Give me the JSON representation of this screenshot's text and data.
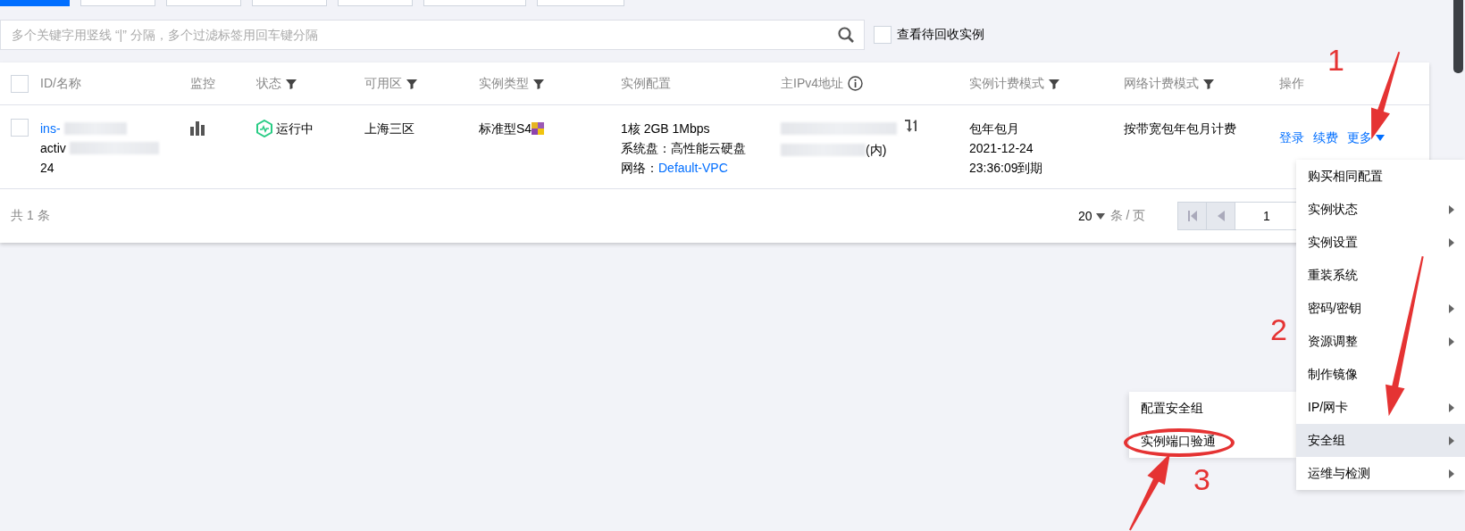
{
  "toolbar_buttons": [
    {
      "kind": "primary"
    },
    {
      "kind": "default"
    },
    {
      "kind": "default"
    },
    {
      "kind": "default"
    },
    {
      "kind": "default"
    },
    {
      "kind": "default"
    },
    {
      "kind": "default"
    }
  ],
  "search": {
    "placeholder": "多个关键字用竖线 “|” 分隔，多个过滤标签用回车键分隔"
  },
  "recycle_toggle": {
    "label": "查看待回收实例",
    "checked": false
  },
  "table": {
    "select_all": {
      "checked": false
    },
    "columns": [
      {
        "label": "ID/名称",
        "kind": "plain"
      },
      {
        "label": "监控",
        "kind": "plain"
      },
      {
        "label": "状态",
        "kind": "filter"
      },
      {
        "label": "可用区",
        "kind": "filter"
      },
      {
        "label": "实例类型",
        "kind": "filter"
      },
      {
        "label": "实例配置",
        "kind": "plain"
      },
      {
        "label": "主IPv4地址",
        "kind": "info"
      },
      {
        "label": "实例计费模式",
        "kind": "filter"
      },
      {
        "label": "网络计费模式",
        "kind": "filter"
      },
      {
        "label": "操作",
        "kind": "plain"
      }
    ],
    "rows": [
      {
        "checked": false,
        "id": "ins-",
        "name": "activ",
        "name_end": "24",
        "status": "运行中",
        "zone": "上海三区",
        "type": "标准型S4",
        "config": [
          "1核 2GB 1Mbps",
          "系统盘：高性能云硬盘"
        ],
        "network_label": "网络：",
        "network": "Default-VPC",
        "ip_note": "(内)",
        "billing": [
          "包年包月",
          "2021-12-24",
          "23:36:09到期"
        ],
        "network_billing": "按带宽包年包月计费",
        "actions": [
          "登录",
          "续费",
          "更多"
        ]
      }
    ]
  },
  "footer": {
    "total": "共 1 条",
    "page_size": "20",
    "page_size_unit": "条 / 页",
    "page": "1"
  },
  "menu": {
    "items": [
      {
        "label": "购买相同配置",
        "submenu": false,
        "selected": false
      },
      {
        "label": "实例状态",
        "submenu": true,
        "selected": false
      },
      {
        "label": "实例设置",
        "submenu": true,
        "selected": false
      },
      {
        "label": "重装系统",
        "submenu": false,
        "selected": false
      },
      {
        "label": "密码/密钥",
        "submenu": true,
        "selected": false
      },
      {
        "label": "资源调整",
        "submenu": true,
        "selected": false
      },
      {
        "label": "制作镜像",
        "submenu": false,
        "selected": false
      },
      {
        "label": "IP/网卡",
        "submenu": true,
        "selected": false
      },
      {
        "label": "安全组",
        "submenu": true,
        "selected": true
      },
      {
        "label": "运维与检测",
        "submenu": true,
        "selected": false
      }
    ],
    "submenu": [
      {
        "label": "配置安全组",
        "selected": false,
        "circled": false
      },
      {
        "label": "实例端口验通",
        "selected": false,
        "circled": true
      }
    ]
  },
  "annotations": [
    {
      "label": "1"
    },
    {
      "label": "2"
    },
    {
      "label": "3"
    }
  ]
}
